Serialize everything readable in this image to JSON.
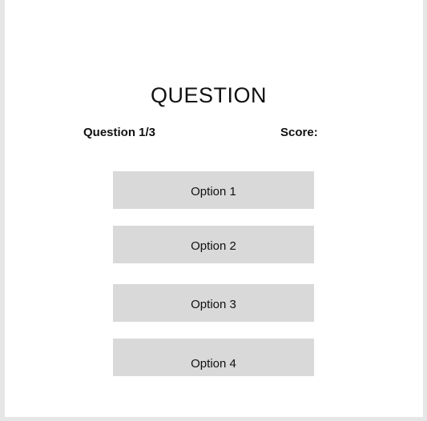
{
  "quiz": {
    "title": "QUESTION",
    "question_counter": "Question 1/3",
    "score_label": "Score:",
    "options": [
      {
        "label": "Option 1"
      },
      {
        "label": "Option 2"
      },
      {
        "label": "Option 3"
      },
      {
        "label": "Option 4"
      }
    ]
  },
  "colors": {
    "background": "#e6e6e6",
    "panel": "#ffffff",
    "option_fill": "#d9d9d9",
    "text": "#111111"
  }
}
